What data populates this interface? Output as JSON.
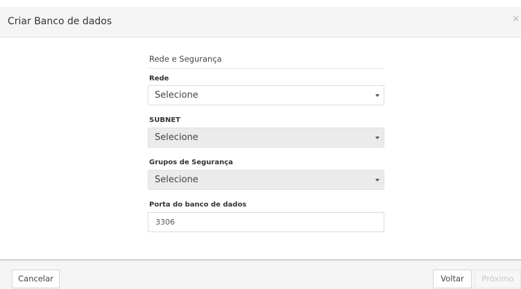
{
  "modal": {
    "title": "Criar Banco de dados",
    "close_symbol": "×"
  },
  "section": {
    "title": "Rede e Segurança"
  },
  "fields": {
    "rede": {
      "label": "Rede",
      "value": "Selecione",
      "disabled": false
    },
    "subnet": {
      "label": "SUBNET",
      "value": "Selecione",
      "disabled": true
    },
    "grupos": {
      "label": "Grupos de Segurança",
      "value": "Selecione",
      "disabled": true
    },
    "porta": {
      "label": "Porta do banco de dados",
      "value": "3306"
    }
  },
  "footer": {
    "cancel_label": "Cancelar",
    "back_label": "Voltar",
    "next_label": "Próximo",
    "next_disabled": true
  },
  "icons": {
    "close": "close-icon",
    "dropdown": "caret-down-icon"
  },
  "colors": {
    "header_bg": "#f5f5f5",
    "disabled_select_bg": "#ebebeb",
    "border": "#dcdcdc",
    "disabled_text": "#c8c8c8"
  }
}
